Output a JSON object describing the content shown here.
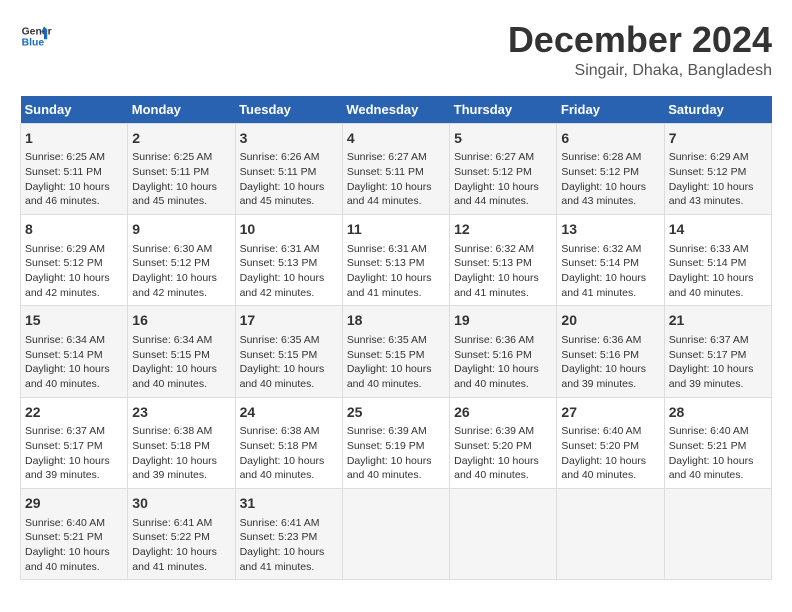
{
  "logo": {
    "line1": "General",
    "line2": "Blue"
  },
  "title": "December 2024",
  "subtitle": "Singair, Dhaka, Bangladesh",
  "days_header": [
    "Sunday",
    "Monday",
    "Tuesday",
    "Wednesday",
    "Thursday",
    "Friday",
    "Saturday"
  ],
  "weeks": [
    [
      {
        "day": "1",
        "sunrise": "6:25 AM",
        "sunset": "5:11 PM",
        "daylight": "10 hours and 46 minutes."
      },
      {
        "day": "2",
        "sunrise": "6:25 AM",
        "sunset": "5:11 PM",
        "daylight": "10 hours and 45 minutes."
      },
      {
        "day": "3",
        "sunrise": "6:26 AM",
        "sunset": "5:11 PM",
        "daylight": "10 hours and 45 minutes."
      },
      {
        "day": "4",
        "sunrise": "6:27 AM",
        "sunset": "5:11 PM",
        "daylight": "10 hours and 44 minutes."
      },
      {
        "day": "5",
        "sunrise": "6:27 AM",
        "sunset": "5:12 PM",
        "daylight": "10 hours and 44 minutes."
      },
      {
        "day": "6",
        "sunrise": "6:28 AM",
        "sunset": "5:12 PM",
        "daylight": "10 hours and 43 minutes."
      },
      {
        "day": "7",
        "sunrise": "6:29 AM",
        "sunset": "5:12 PM",
        "daylight": "10 hours and 43 minutes."
      }
    ],
    [
      {
        "day": "8",
        "sunrise": "6:29 AM",
        "sunset": "5:12 PM",
        "daylight": "10 hours and 42 minutes."
      },
      {
        "day": "9",
        "sunrise": "6:30 AM",
        "sunset": "5:12 PM",
        "daylight": "10 hours and 42 minutes."
      },
      {
        "day": "10",
        "sunrise": "6:31 AM",
        "sunset": "5:13 PM",
        "daylight": "10 hours and 42 minutes."
      },
      {
        "day": "11",
        "sunrise": "6:31 AM",
        "sunset": "5:13 PM",
        "daylight": "10 hours and 41 minutes."
      },
      {
        "day": "12",
        "sunrise": "6:32 AM",
        "sunset": "5:13 PM",
        "daylight": "10 hours and 41 minutes."
      },
      {
        "day": "13",
        "sunrise": "6:32 AM",
        "sunset": "5:14 PM",
        "daylight": "10 hours and 41 minutes."
      },
      {
        "day": "14",
        "sunrise": "6:33 AM",
        "sunset": "5:14 PM",
        "daylight": "10 hours and 40 minutes."
      }
    ],
    [
      {
        "day": "15",
        "sunrise": "6:34 AM",
        "sunset": "5:14 PM",
        "daylight": "10 hours and 40 minutes."
      },
      {
        "day": "16",
        "sunrise": "6:34 AM",
        "sunset": "5:15 PM",
        "daylight": "10 hours and 40 minutes."
      },
      {
        "day": "17",
        "sunrise": "6:35 AM",
        "sunset": "5:15 PM",
        "daylight": "10 hours and 40 minutes."
      },
      {
        "day": "18",
        "sunrise": "6:35 AM",
        "sunset": "5:15 PM",
        "daylight": "10 hours and 40 minutes."
      },
      {
        "day": "19",
        "sunrise": "6:36 AM",
        "sunset": "5:16 PM",
        "daylight": "10 hours and 40 minutes."
      },
      {
        "day": "20",
        "sunrise": "6:36 AM",
        "sunset": "5:16 PM",
        "daylight": "10 hours and 39 minutes."
      },
      {
        "day": "21",
        "sunrise": "6:37 AM",
        "sunset": "5:17 PM",
        "daylight": "10 hours and 39 minutes."
      }
    ],
    [
      {
        "day": "22",
        "sunrise": "6:37 AM",
        "sunset": "5:17 PM",
        "daylight": "10 hours and 39 minutes."
      },
      {
        "day": "23",
        "sunrise": "6:38 AM",
        "sunset": "5:18 PM",
        "daylight": "10 hours and 39 minutes."
      },
      {
        "day": "24",
        "sunrise": "6:38 AM",
        "sunset": "5:18 PM",
        "daylight": "10 hours and 40 minutes."
      },
      {
        "day": "25",
        "sunrise": "6:39 AM",
        "sunset": "5:19 PM",
        "daylight": "10 hours and 40 minutes."
      },
      {
        "day": "26",
        "sunrise": "6:39 AM",
        "sunset": "5:20 PM",
        "daylight": "10 hours and 40 minutes."
      },
      {
        "day": "27",
        "sunrise": "6:40 AM",
        "sunset": "5:20 PM",
        "daylight": "10 hours and 40 minutes."
      },
      {
        "day": "28",
        "sunrise": "6:40 AM",
        "sunset": "5:21 PM",
        "daylight": "10 hours and 40 minutes."
      }
    ],
    [
      {
        "day": "29",
        "sunrise": "6:40 AM",
        "sunset": "5:21 PM",
        "daylight": "10 hours and 40 minutes."
      },
      {
        "day": "30",
        "sunrise": "6:41 AM",
        "sunset": "5:22 PM",
        "daylight": "10 hours and 41 minutes."
      },
      {
        "day": "31",
        "sunrise": "6:41 AM",
        "sunset": "5:23 PM",
        "daylight": "10 hours and 41 minutes."
      },
      null,
      null,
      null,
      null
    ]
  ],
  "labels": {
    "sunrise": "Sunrise:",
    "sunset": "Sunset:",
    "daylight": "Daylight:"
  }
}
